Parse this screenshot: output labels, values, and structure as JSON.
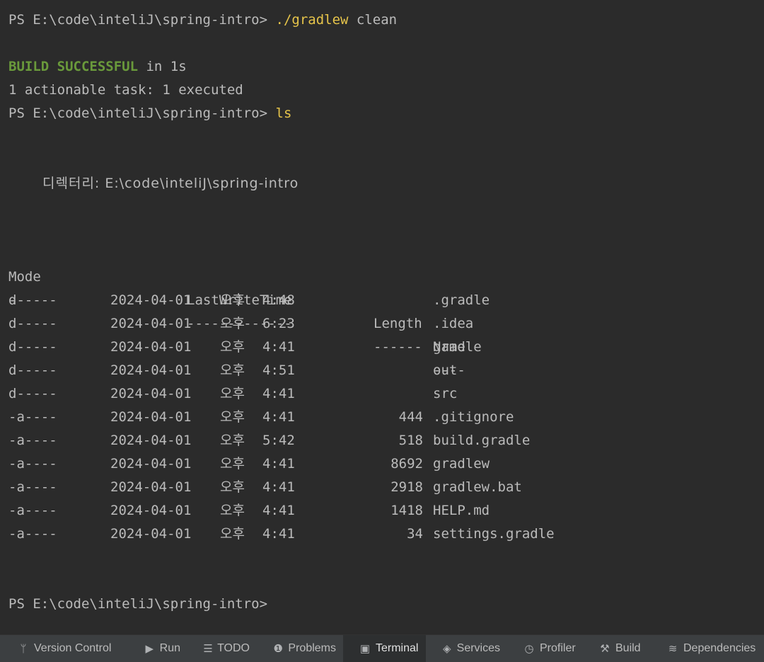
{
  "terminal": {
    "prompt": "PS E:\\code\\inteliJ\\spring-intro>",
    "cmd1": "./gradlew",
    "cmd1_arg": "clean",
    "build_status": "BUILD SUCCESSFUL",
    "build_time": "in 1s",
    "task_summary": "1 actionable task: 1 executed",
    "cmd2": "ls",
    "directory_label": "디렉터리: E:\\code\\inteliJ\\spring-intro",
    "headers": {
      "mode": "Mode",
      "time": "LastWriteTime",
      "length": "Length",
      "name": "Name"
    },
    "separators": {
      "mode": "----",
      "time": "-------------",
      "length": "------",
      "name": "----"
    },
    "rows": [
      {
        "mode": "d-----",
        "date": "2024-04-01",
        "ampm": "오후",
        "time": "4:48",
        "length": "",
        "name": ".gradle"
      },
      {
        "mode": "d-----",
        "date": "2024-04-01",
        "ampm": "오후",
        "time": "6:23",
        "length": "",
        "name": ".idea"
      },
      {
        "mode": "d-----",
        "date": "2024-04-01",
        "ampm": "오후",
        "time": "4:41",
        "length": "",
        "name": "gradle"
      },
      {
        "mode": "d-----",
        "date": "2024-04-01",
        "ampm": "오후",
        "time": "4:51",
        "length": "",
        "name": "out"
      },
      {
        "mode": "d-----",
        "date": "2024-04-01",
        "ampm": "오후",
        "time": "4:41",
        "length": "",
        "name": "src"
      },
      {
        "mode": "-a----",
        "date": "2024-04-01",
        "ampm": "오후",
        "time": "4:41",
        "length": "444",
        "name": ".gitignore"
      },
      {
        "mode": "-a----",
        "date": "2024-04-01",
        "ampm": "오후",
        "time": "5:42",
        "length": "518",
        "name": "build.gradle"
      },
      {
        "mode": "-a----",
        "date": "2024-04-01",
        "ampm": "오후",
        "time": "4:41",
        "length": "8692",
        "name": "gradlew"
      },
      {
        "mode": "-a----",
        "date": "2024-04-01",
        "ampm": "오후",
        "time": "4:41",
        "length": "2918",
        "name": "gradlew.bat"
      },
      {
        "mode": "-a----",
        "date": "2024-04-01",
        "ampm": "오후",
        "time": "4:41",
        "length": "1418",
        "name": "HELP.md"
      },
      {
        "mode": "-a----",
        "date": "2024-04-01",
        "ampm": "오후",
        "time": "4:41",
        "length": "34",
        "name": "settings.gradle"
      }
    ]
  },
  "toolbar": {
    "tabs": [
      {
        "key": "version-control",
        "label": "Version Control",
        "icon": "branch-icon",
        "active": false
      },
      {
        "key": "run",
        "label": "Run",
        "icon": "play-icon",
        "active": false
      },
      {
        "key": "todo",
        "label": "TODO",
        "icon": "list-icon",
        "active": false
      },
      {
        "key": "problems",
        "label": "Problems",
        "icon": "warning-icon",
        "active": false
      },
      {
        "key": "terminal",
        "label": "Terminal",
        "icon": "terminal-icon",
        "active": true
      },
      {
        "key": "services",
        "label": "Services",
        "icon": "services-icon",
        "active": false
      },
      {
        "key": "profiler",
        "label": "Profiler",
        "icon": "profiler-icon",
        "active": false
      },
      {
        "key": "build",
        "label": "Build",
        "icon": "hammer-icon",
        "active": false
      },
      {
        "key": "dependencies",
        "label": "Dependencies",
        "icon": "layers-icon",
        "active": false
      }
    ]
  },
  "colors": {
    "background": "#2b2b2b",
    "text": "#bbbbbb",
    "command": "#e6c44a",
    "success": "#6a9a3b",
    "toolbar": "#3c3f41"
  }
}
